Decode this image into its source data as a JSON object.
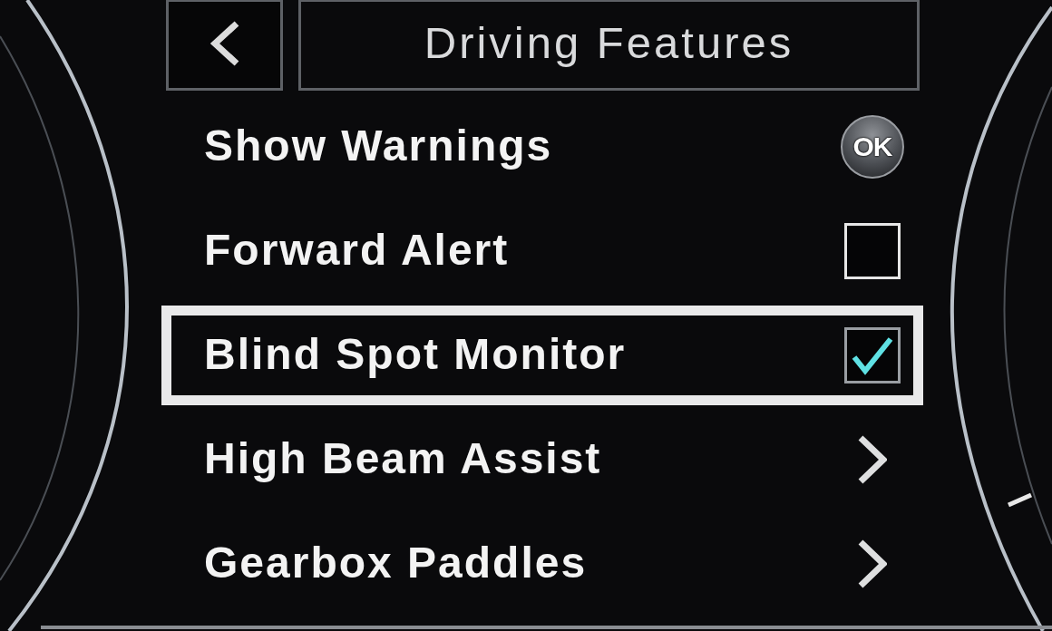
{
  "header": {
    "title": "Driving Features"
  },
  "menu": {
    "items": [
      {
        "label": "Show Warnings",
        "kind": "ok",
        "badge": "OK",
        "selected": false
      },
      {
        "label": "Forward Alert",
        "kind": "checkbox",
        "checked": false,
        "selected": false
      },
      {
        "label": "Blind Spot Monitor",
        "kind": "checkbox",
        "checked": true,
        "selected": true
      },
      {
        "label": "High Beam Assist",
        "kind": "submenu",
        "selected": false
      },
      {
        "label": "Gearbox Paddles",
        "kind": "submenu",
        "selected": false
      }
    ]
  }
}
